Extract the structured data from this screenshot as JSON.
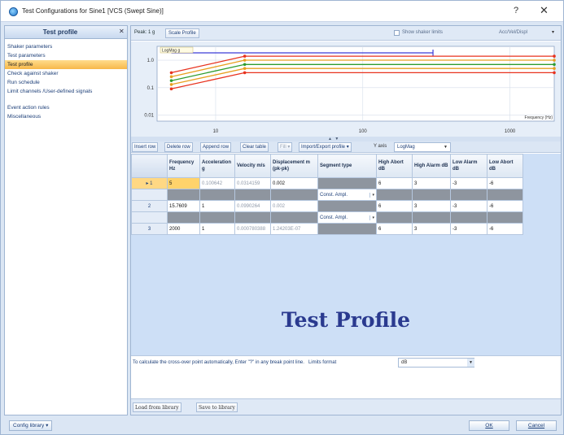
{
  "window": {
    "title": "Test Configurations for Sine1 [VCS (Swept Sine)]",
    "help": "?",
    "close": "✕"
  },
  "left_panel": {
    "title": "Test profile",
    "pin": "✕",
    "items": [
      {
        "label": "Shaker parameters",
        "selected": false
      },
      {
        "label": "Test parameters",
        "selected": false
      },
      {
        "label": "Test profile",
        "selected": true
      },
      {
        "label": "Check against shaker",
        "selected": false
      },
      {
        "label": "Run schedule",
        "selected": false
      },
      {
        "label": "Limit channels /User-defined signals",
        "selected": false
      },
      {
        "label": "Event action rules",
        "selected": false
      },
      {
        "label": "Miscellaneous",
        "selected": false
      }
    ]
  },
  "chart_toolbar": {
    "peak": "Peak: 1 g",
    "scale_profile": "Scale Profile",
    "show_shaker_limits": "Show shaker limits",
    "units": "Acc/Vel/Displ"
  },
  "chart_data": {
    "type": "line",
    "title": "",
    "xlabel": "Frequency (Hz)",
    "ylabel": "",
    "xscale": "log",
    "yscale": "log",
    "legend": "LogMag g",
    "x_ticks": [
      "10",
      "100",
      "1000"
    ],
    "y_ticks": [
      "1.0",
      "0.1",
      "0.01"
    ],
    "x": [
      5,
      15.7609,
      2000
    ],
    "series": [
      {
        "name": "High Abort",
        "color": "#e8321e",
        "values": [
          0.35,
          1.4,
          1.4
        ]
      },
      {
        "name": "High Alarm",
        "color": "#e8a020",
        "values": [
          0.25,
          1.0,
          1.0
        ]
      },
      {
        "name": "Profile",
        "color": "#2e9c2e",
        "values": [
          0.18,
          0.7,
          0.7
        ]
      },
      {
        "name": "Low Alarm",
        "color": "#e8a020",
        "values": [
          0.13,
          0.5,
          0.5
        ]
      },
      {
        "name": "Low Abort",
        "color": "#e8321e",
        "values": [
          0.09,
          0.35,
          0.35
        ]
      }
    ],
    "range_bar_color": "#3c3cd8"
  },
  "splitter_grip": "▲ ▼",
  "grid_toolbar": {
    "insert_row": "Insert row",
    "delete_row": "Delete row",
    "append_row": "Append row",
    "clear_table": "Clear table",
    "fill": "Fill ▾",
    "import_export": "Import/Export profile ▾",
    "y_axis_label": "Y axis",
    "y_axis_value": "LogMag",
    "dropdown_arrow": "▼"
  },
  "grid": {
    "columns": [
      "",
      "Frequency Hz",
      "Acceleration g",
      "Velocity m/s",
      "Displacement m (pk-pk)",
      "Segment type",
      "High Abort dB",
      "High Alarm dB",
      "Low Alarm dB",
      "Low Abort dB"
    ],
    "rows": [
      {
        "num": "1",
        "frequency": "5",
        "acceleration": "0.100642",
        "velocity": "0.0314159",
        "displacement": "0.002",
        "high_abort": "6",
        "high_alarm": "3",
        "low_alarm": "-3",
        "low_abort": "-6"
      },
      {
        "num": "2",
        "frequency": "15.7609",
        "acceleration": "1",
        "velocity": "0.0990264",
        "displacement": "0.002",
        "high_abort": "6",
        "high_alarm": "3",
        "low_alarm": "-3",
        "low_abort": "-6"
      },
      {
        "num": "3",
        "frequency": "2000",
        "acceleration": "1",
        "velocity": "0.000780388",
        "displacement": "1.24203E-07",
        "high_abort": "6",
        "high_alarm": "3",
        "low_alarm": "-3",
        "low_abort": "-6"
      }
    ],
    "segments": [
      "Const. Ampl.",
      "Const. Ampl."
    ],
    "row_marker": "▸",
    "seg_arrow": "▾"
  },
  "watermark": "Test Profile",
  "info": {
    "text": "To calculate the cross-over point automatically, Enter \"?\" in any break point line.",
    "limits_label": "Limits format",
    "limits_value": "dB",
    "dropdown_arrow": "▼"
  },
  "library": {
    "load": "Load from library",
    "save": "Save to library"
  },
  "bottom": {
    "config_library": "Config library ▾",
    "ok": "OK",
    "cancel": "Cancel"
  }
}
